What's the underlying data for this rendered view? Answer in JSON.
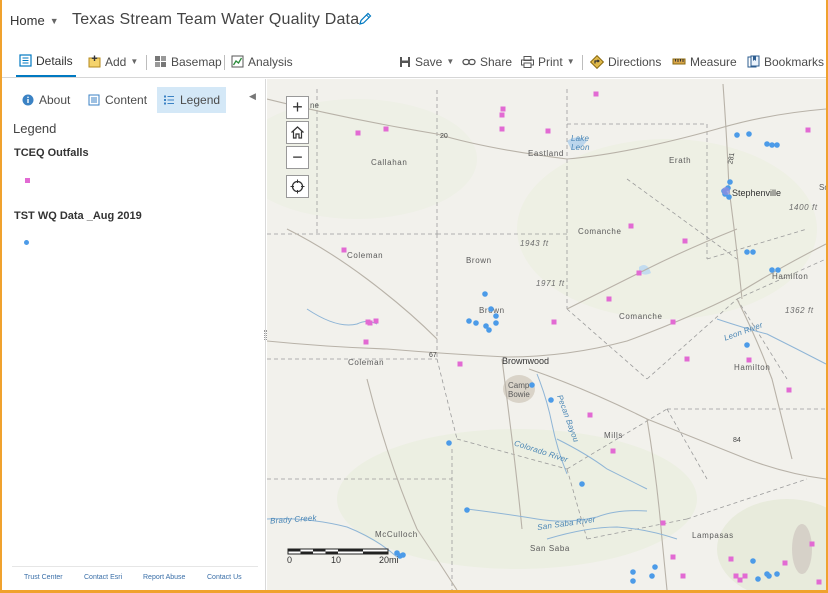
{
  "header": {
    "home_label": "Home",
    "title": "Texas Stream Team Water Quality Data"
  },
  "toolbar": {
    "details": "Details",
    "add": "Add",
    "basemap": "Basemap",
    "analysis": "Analysis",
    "save": "Save",
    "share": "Share",
    "print": "Print",
    "directions": "Directions",
    "measure": "Measure",
    "bookmarks": "Bookmarks"
  },
  "sidebar": {
    "tabs": [
      "About",
      "Content",
      "Legend"
    ],
    "active_tab": "Legend",
    "legend_heading": "Legend",
    "layers": [
      {
        "title": "TCEQ Outfalls",
        "symbol": "pink-square",
        "color": "#e26ad3"
      },
      {
        "title": "TST WQ Data _Aug 2019",
        "symbol": "blue-dot",
        "color": "#4c9be8"
      }
    ],
    "footer_links": [
      "Trust Center",
      "Contact Esri",
      "Report Abuse",
      "Contact Us"
    ]
  },
  "map": {
    "labels": {
      "callahan": "Callahan",
      "eastland": "Eastland",
      "erath": "Erath",
      "stephenville": "Stephenville",
      "lake_leon": "Lake\nLeon",
      "comanche1": "Comanche",
      "comanche2": "Comanche",
      "coleman1": "Coleman",
      "coleman2": "Coleman",
      "brown1": "Brown",
      "brown2": "Brown",
      "brownwood": "Brownwood",
      "camp_bowie": "Camp\nBowie",
      "hamilton1": "Hamilton",
      "hamilton2": "Hamilton",
      "mills": "Mills",
      "lampasas": "Lampasas",
      "mcculloch": "McCulloch",
      "san_saba": "San Saba",
      "san_saba_river": "San Saba River",
      "brady_creek": "Brady Creek",
      "colorado_river": "Colorado River",
      "pecan_bayou": "Pecan Bayou",
      "leon_river": "Leon River",
      "elev_1943": "1943 ft",
      "elev_1971": "1971 ft",
      "elev_1400": "1400 ft",
      "elev_1362": "1362 ft",
      "road_20": "20",
      "road_67": "67",
      "road_84": "84",
      "road_281": "281",
      "partial_ne": "ne",
      "partial_sc": "Sc"
    },
    "scale": {
      "labels": [
        "0",
        "10",
        "20mi"
      ]
    },
    "colors": {
      "outfall": "#e26ad3",
      "wq_site": "#4c9be8",
      "accent": "#f0a22e"
    }
  }
}
